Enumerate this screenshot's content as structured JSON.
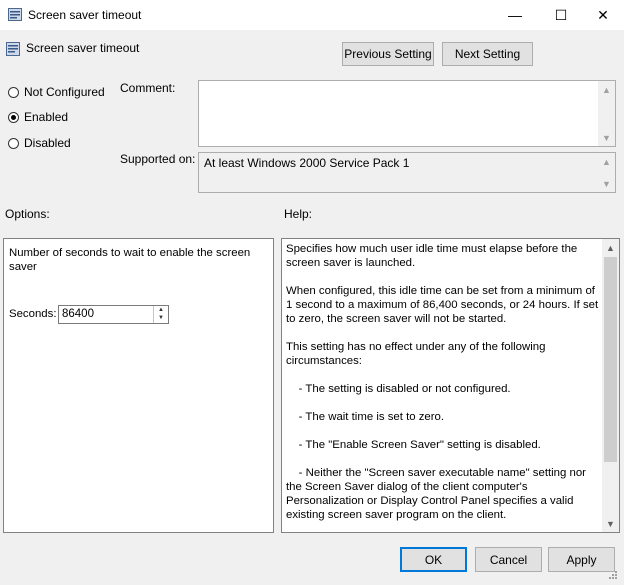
{
  "window": {
    "title": "Screen saver timeout",
    "icon": "policy-icon",
    "controls": {
      "minimize": "—",
      "maximize": "☐",
      "close": "✕"
    }
  },
  "header": {
    "setting_name": "Screen saver timeout",
    "previous_label": "Previous Setting",
    "next_label": "Next Setting"
  },
  "state": {
    "options": [
      {
        "label": "Not Configured",
        "checked": false
      },
      {
        "label": "Enabled",
        "checked": true
      },
      {
        "label": "Disabled",
        "checked": false
      }
    ]
  },
  "comment": {
    "label": "Comment:",
    "value": ""
  },
  "supported": {
    "label": "Supported on:",
    "value": "At least Windows 2000 Service Pack 1"
  },
  "options_section": {
    "label": "Options:",
    "description": "Number of seconds to wait to enable the screen saver",
    "seconds_label": "Seconds:",
    "seconds_value": "86400"
  },
  "help_section": {
    "label": "Help:",
    "paragraphs": [
      "Specifies how much user idle time must elapse before the screen saver is launched.",
      "When configured, this idle time can be set from a minimum of 1 second to a maximum of 86,400 seconds, or 24 hours. If set to zero, the screen saver will not be started.",
      "This setting has no effect under any of the following circumstances:",
      "    - The setting is disabled or not configured.",
      "    - The wait time is set to zero.",
      "    - The \"Enable Screen Saver\" setting is disabled.",
      "    - Neither the \"Screen saver executable name\" setting nor the Screen Saver dialog of the client computer's Personalization or Display Control Panel specifies a valid existing screen saver program on the client."
    ]
  },
  "footer": {
    "ok": "OK",
    "cancel": "Cancel",
    "apply": "Apply"
  },
  "colors": {
    "accent": "#0078d7",
    "window_bg": "#f0f0f0"
  }
}
